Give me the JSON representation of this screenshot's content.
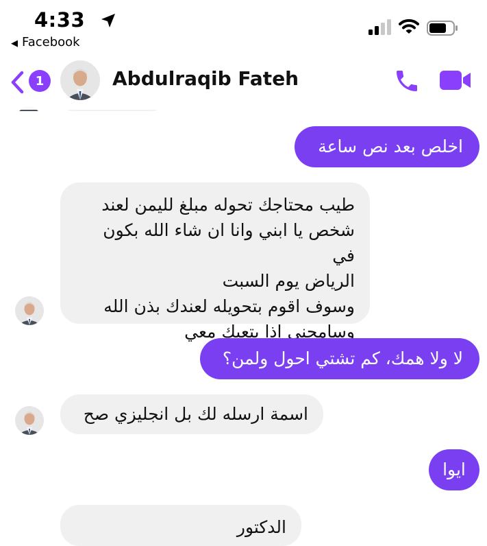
{
  "status": {
    "time": "4:33",
    "back_app": "Facebook"
  },
  "header": {
    "badge": "1",
    "name": "Abdulraqib Fateh"
  },
  "messages": [
    {
      "from": "me",
      "text": "اخلص بعد نص ساعة"
    },
    {
      "from": "them",
      "lines": [
        "طيب محتاجك تحوله مبلغ لليمن لعند",
        "شخص يا ابني وانا ان شاء الله بكون في",
        "الرياض يوم السبت",
        "وسوف اقوم بتحويله لعندك بذن الله",
        "وسامحني اذا بتعبك معي"
      ]
    },
    {
      "from": "me",
      "text": "لا ولا همك، كم تشتي احول ولمن؟"
    },
    {
      "from": "them",
      "text": "اسمة ارسله لك بل انجليزي صح"
    },
    {
      "from": "me",
      "text": "ايوا"
    },
    {
      "from": "them",
      "text": "الدكتور"
    }
  ],
  "colors": {
    "accent": "#7b3ff2",
    "incoming": "#f0f0f0",
    "badge": "#8a3ffc"
  }
}
